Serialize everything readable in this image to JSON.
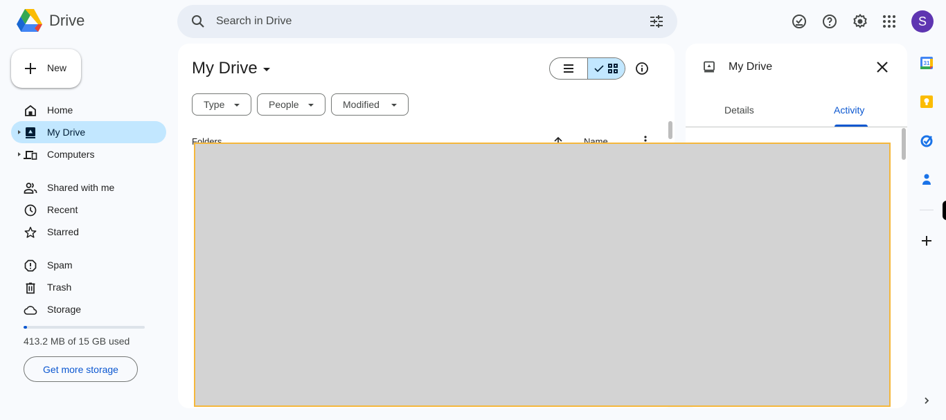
{
  "app": {
    "name": "Drive"
  },
  "search": {
    "placeholder": "Search in Drive",
    "value": ""
  },
  "header": {
    "icons": [
      "offline-ready-icon",
      "help-icon",
      "settings-icon",
      "apps-grid-icon"
    ],
    "avatar_letter": "S",
    "avatar_color": "#5e35b1"
  },
  "sidebar": {
    "new_label": "New",
    "items": [
      {
        "label": "Home",
        "icon": "home-icon",
        "active": false
      },
      {
        "label": "My Drive",
        "icon": "my-drive-icon",
        "active": true,
        "expandable": true
      },
      {
        "label": "Computers",
        "icon": "computers-icon",
        "active": false,
        "expandable": true
      },
      {
        "label": "Shared with me",
        "icon": "shared-icon",
        "active": false
      },
      {
        "label": "Recent",
        "icon": "clock-icon",
        "active": false
      },
      {
        "label": "Starred",
        "icon": "star-icon",
        "active": false
      },
      {
        "label": "Spam",
        "icon": "spam-icon",
        "active": false
      },
      {
        "label": "Trash",
        "icon": "trash-icon",
        "active": false
      },
      {
        "label": "Storage",
        "icon": "cloud-icon",
        "active": false
      }
    ],
    "storage": {
      "used_text": "413.2 MB of 15 GB used",
      "used_fraction": 0.027,
      "button": "Get more storage"
    }
  },
  "main": {
    "title": "My Drive",
    "filters": [
      "Type",
      "People",
      "Modified"
    ],
    "view_modes": {
      "list": "list-view",
      "grid": "grid-view",
      "selected": "grid"
    },
    "section_partial": "Folders",
    "sort_label": "Name"
  },
  "details_panel": {
    "title": "My Drive",
    "tabs": [
      "Details",
      "Activity"
    ],
    "active_tab": "Activity"
  },
  "side_apps": [
    "Calendar",
    "Keep",
    "Tasks",
    "Contacts"
  ],
  "colors": {
    "accent": "#0b57d0",
    "selected_bg": "#c2e7ff",
    "overlay": "#d3d3d3",
    "overlay_border": "#f5b73b"
  }
}
